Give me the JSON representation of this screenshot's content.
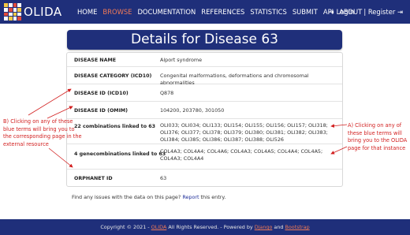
{
  "navbar": {
    "brand": "OLIDA",
    "items": [
      {
        "label": "HOME"
      },
      {
        "label": "BROWSE",
        "active": true
      },
      {
        "label": "DOCUMENTATION"
      },
      {
        "label": "REFERENCES"
      },
      {
        "label": "STATISTICS"
      },
      {
        "label": "SUBMIT"
      },
      {
        "label": "API"
      },
      {
        "label": "ABOUT"
      }
    ],
    "login_label": "LogIn",
    "register_label": "Register",
    "register_sep": "|"
  },
  "page_title": "Details for Disease 63",
  "details": {
    "disease_name": {
      "label": "DISEASE NAME",
      "value": "Alport syndrome"
    },
    "category": {
      "label": "DISEASE CATEGORY (ICD10)",
      "value": "Congenital malformations, deformations and chromosomal abnormalities"
    },
    "icd10": {
      "label": "DISEASE ID (ICD10)",
      "value": "Q878"
    },
    "omim": {
      "label": "DISEASE ID (OMIM)",
      "value": "104200, 203780, 301050"
    },
    "combinations": {
      "label": "22 combinations linked to 63",
      "value": "OLI033; OLI034; OLI133; OLI154; OLI155; OLI156; OLI157; OLI318; OLI376; OLI377; OLI378; OLI379; OLI380; OLI381; OLI382; OLI383; OLI384; OLI385; OLI386; OLI387; OLI388; OLI526"
    },
    "genecombinations": {
      "label": "4 genecombinations linked to 63",
      "value": "COL4A3; COL4A4; COL4A6; COL4A3; COL4A5; COL4A4; COL4A5; COL4A3; COL4A4"
    },
    "orphanet": {
      "label": "ORPHANET ID",
      "value": "63"
    }
  },
  "issue_note": {
    "prefix": "Find any issues with the data on this page?",
    "link": "Report",
    "suffix": "this entry."
  },
  "annotations": {
    "left": "B) Clicking on any of these blue terms will bring you to the corresponding page in the external resource",
    "right": "A) Clicking on any of these blue terms will bring you to the OLIDA page for that instance"
  },
  "footer": {
    "prefix": "Copyright © 2021 -",
    "brand": "OLIDA",
    "middle": "All Rights Reserved. - Powered by",
    "django": "Django",
    "and": "and",
    "bootstrap": "Bootstrap"
  },
  "colors": {
    "navy": "#1f2f7a",
    "accent": "#f07a57",
    "link": "#1f2f9a",
    "annotation": "#d21f1f"
  }
}
